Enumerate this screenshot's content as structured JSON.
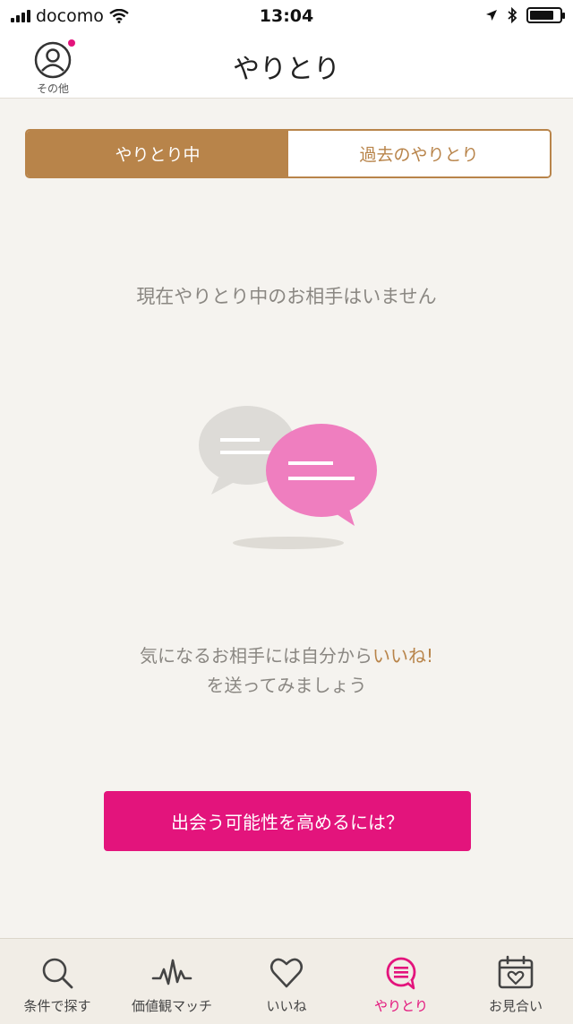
{
  "status_bar": {
    "carrier": "docomo",
    "time": "13:04"
  },
  "header": {
    "title": "やりとり",
    "other_label": "その他"
  },
  "segments": [
    {
      "label": "やりとり中",
      "active": true
    },
    {
      "label": "過去のやりとり",
      "active": false
    }
  ],
  "empty_state": {
    "message": "現在やりとり中のお相手はいません",
    "hint_line1_prefix": "気になるお相手には自分から",
    "hint_line1_accent": "いいね!",
    "hint_line2": "を送ってみましょう"
  },
  "cta": {
    "label": "出会う可能性を高めるには？"
  },
  "tab_bar": {
    "items": [
      {
        "label": "条件で探す",
        "icon": "search-icon"
      },
      {
        "label": "価値観マッチ",
        "icon": "pulse-icon"
      },
      {
        "label": "いいね",
        "icon": "heart-icon"
      },
      {
        "label": "やりとり",
        "icon": "chat-icon",
        "active": true
      },
      {
        "label": "お見合い",
        "icon": "calendar-heart-icon"
      }
    ]
  },
  "colors": {
    "accent_brown": "#b8844a",
    "accent_pink": "#e3147c",
    "background": "#f5f3ef"
  }
}
